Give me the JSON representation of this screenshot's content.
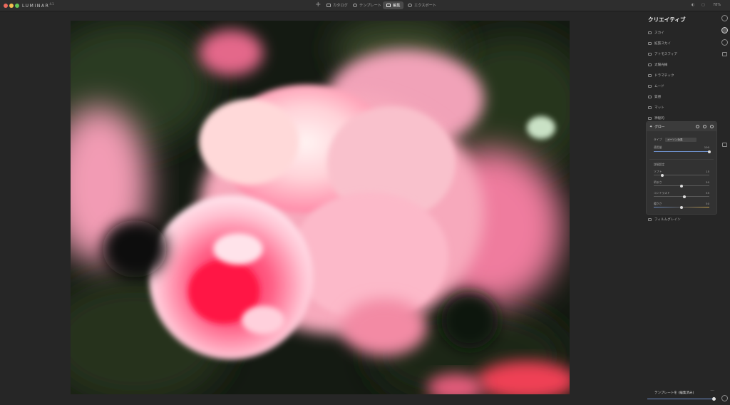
{
  "app": {
    "brand": "LUMINAR",
    "brand_version": "4.1"
  },
  "nav": {
    "tabs": [
      {
        "label": "カタログ",
        "active": false
      },
      {
        "label": "テンプレート",
        "active": false
      },
      {
        "label": "編集",
        "active": true
      },
      {
        "label": "エクスポート",
        "active": false
      }
    ],
    "zoom": "78%"
  },
  "panel": {
    "title": "クリエイティブ",
    "filters": [
      {
        "label": "スカイ",
        "icon": "sky-icon"
      },
      {
        "label": "拡張スカイ",
        "icon": "augmented-sky-icon"
      },
      {
        "label": "アトモスフィア",
        "icon": "atmosphere-icon"
      },
      {
        "label": "太陽光線",
        "icon": "sunrays-icon"
      },
      {
        "label": "ドラマチック",
        "icon": "dramatic-icon"
      },
      {
        "label": "ムード",
        "icon": "mood-icon"
      },
      {
        "label": "質感",
        "icon": "texture-icon"
      },
      {
        "label": "マット",
        "icon": "matte-icon"
      },
      {
        "label": "神秘的",
        "icon": "mystical-icon"
      }
    ],
    "glow": {
      "title": "グロー",
      "type_label": "タイプ",
      "type_value": "オーソン効果",
      "amount_label": "適用量",
      "amount_value": 100,
      "advanced_label": "詳細設定",
      "sliders": [
        {
          "label": "ソフト",
          "value": 15,
          "max": 100
        },
        {
          "label": "明るさ",
          "value": 50,
          "max": 100
        },
        {
          "label": "コントラスト",
          "value": 55,
          "max": 100
        },
        {
          "label": "暖かさ",
          "value": 50,
          "max": 100
        }
      ]
    },
    "film_grain": "フィルムグレイン"
  },
  "bottom": {
    "label": "テンプレートを (編集済み)",
    "menu": "···"
  },
  "colors": {
    "accent": "#6e8fc9",
    "traffic_red": "#ec6a5e",
    "traffic_yellow": "#f4bf4f",
    "traffic_green": "#61c554"
  }
}
